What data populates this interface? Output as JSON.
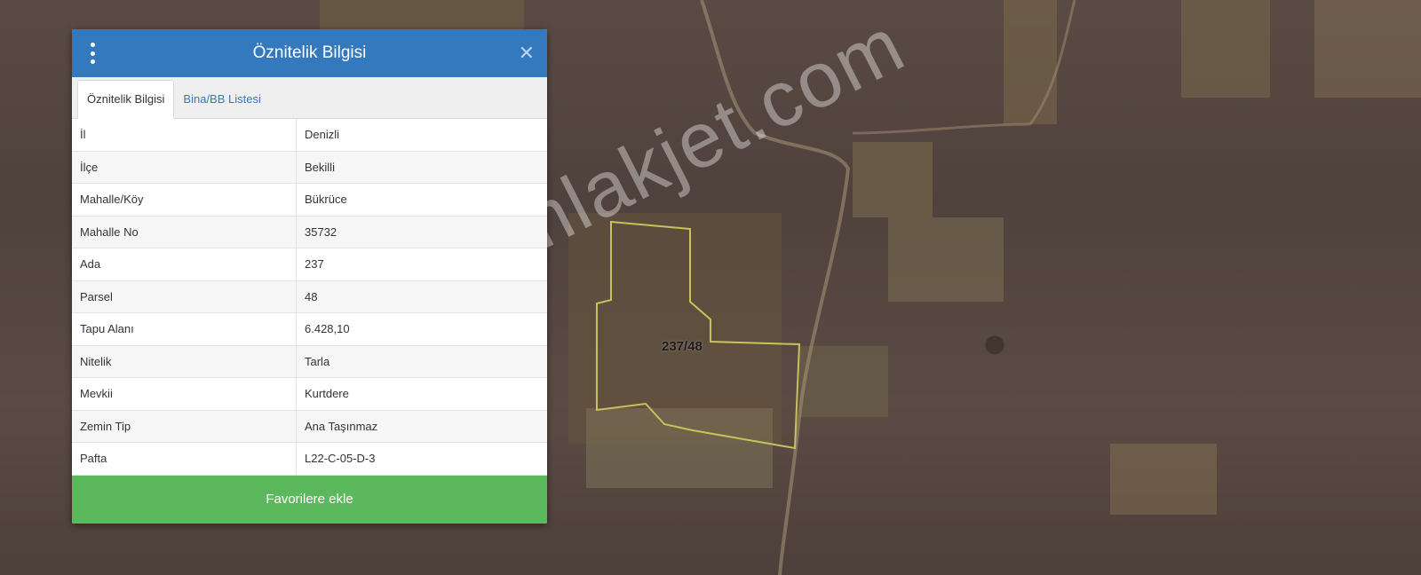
{
  "panel": {
    "title": "Öznitelik Bilgisi",
    "close_icon": "close-icon",
    "menu_icon": "vertical-dots-icon",
    "tabs": [
      {
        "label": "Öznitelik Bilgisi",
        "active": true
      },
      {
        "label": "Bina/BB Listesi",
        "active": false
      }
    ],
    "rows": [
      {
        "key": "İl",
        "value": "Denizli"
      },
      {
        "key": "İlçe",
        "value": "Bekilli"
      },
      {
        "key": "Mahalle/Köy",
        "value": "Bükrüce"
      },
      {
        "key": "Mahalle No",
        "value": "35732"
      },
      {
        "key": "Ada",
        "value": "237"
      },
      {
        "key": "Parsel",
        "value": "48"
      },
      {
        "key": "Tapu Alanı",
        "value": "6.428,10"
      },
      {
        "key": "Nitelik",
        "value": "Tarla"
      },
      {
        "key": "Mevkii",
        "value": "Kurtdere"
      },
      {
        "key": "Zemin Tip",
        "value": "Ana Taşınmaz"
      },
      {
        "key": "Pafta",
        "value": "L22-C-05-D-3"
      }
    ],
    "favorite_button": "Favorilere ekle",
    "colors": {
      "header": "#3479bd",
      "button": "#5cb85c",
      "tab_link": "#3479bd"
    }
  },
  "map": {
    "parcel_label": "237/48",
    "watermark": "emlakjet.com",
    "parcel_outline_color": "#c8c25a"
  }
}
